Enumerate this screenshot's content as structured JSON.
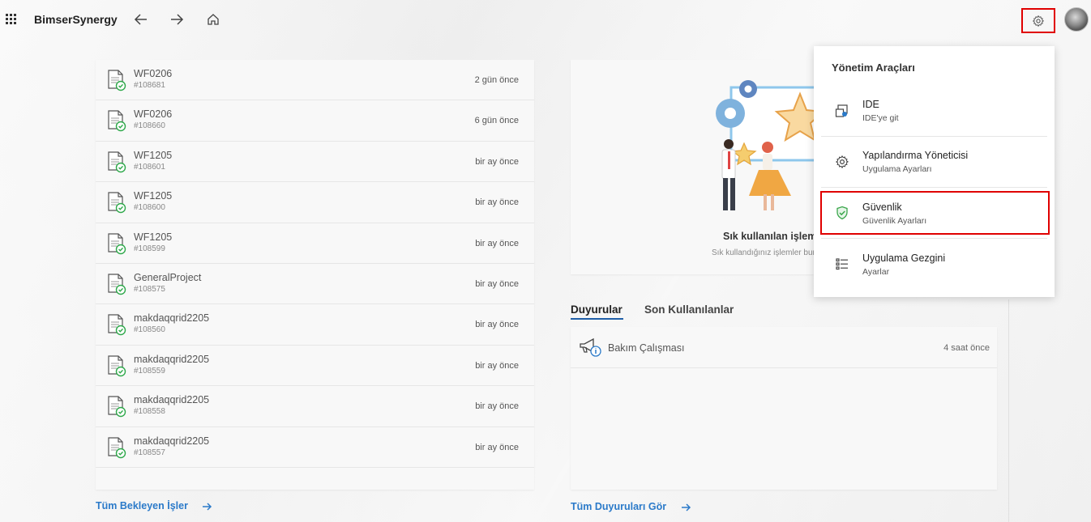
{
  "app": {
    "title": "BimserSynergy"
  },
  "icons": {
    "launcher": "app-launcher-grid-icon",
    "back": "arrow-left-icon",
    "forward": "arrow-right-icon",
    "home": "home-icon",
    "settings": "gear-icon"
  },
  "tasks": {
    "items": [
      {
        "title": "WF0206",
        "id": "#108681",
        "time": "2 gün önce"
      },
      {
        "title": "WF0206",
        "id": "#108660",
        "time": "6 gün önce"
      },
      {
        "title": "WF1205",
        "id": "#108601",
        "time": "bir ay önce"
      },
      {
        "title": "WF1205",
        "id": "#108600",
        "time": "bir ay önce"
      },
      {
        "title": "WF1205",
        "id": "#108599",
        "time": "bir ay önce"
      },
      {
        "title": "GeneralProject",
        "id": "#108575",
        "time": "bir ay önce"
      },
      {
        "title": "makdaqqrid2205",
        "id": "#108560",
        "time": "bir ay önce"
      },
      {
        "title": "makdaqqrid2205",
        "id": "#108559",
        "time": "bir ay önce"
      },
      {
        "title": "makdaqqrid2205",
        "id": "#108558",
        "time": "bir ay önce"
      },
      {
        "title": "makdaqqrid2205",
        "id": "#108557",
        "time": "bir ay önce"
      }
    ],
    "all_link": "Tüm Bekleyen İşler"
  },
  "frequent": {
    "title": "Sık kullanılan işlemler",
    "subtitle": "Sık kullandığınız işlemler burada"
  },
  "tabs": {
    "announcements": "Duyurular",
    "recent": "Son Kullanılanlar"
  },
  "announcements": {
    "items": [
      {
        "title": "Bakım Çalışması",
        "time": "4 saat önce"
      }
    ],
    "all_link": "Tüm Duyuruları Gör"
  },
  "admin_menu": {
    "heading": "Yönetim Araçları",
    "items": [
      {
        "title": "IDE",
        "subtitle": "IDE'ye git",
        "icon": "ide-icon"
      },
      {
        "title": "Yapılandırma Yöneticisi",
        "subtitle": "Uygulama Ayarları",
        "icon": "gear-icon"
      },
      {
        "title": "Güvenlik",
        "subtitle": "Güvenlik Ayarları",
        "icon": "shield-check-icon"
      },
      {
        "title": "Uygulama Gezgini",
        "subtitle": "Ayarlar",
        "icon": "list-icon"
      }
    ]
  },
  "colors": {
    "accent": "#2b7ac9",
    "highlight": "#e00000",
    "success": "#2ea84a",
    "security": "#3aa64b"
  }
}
